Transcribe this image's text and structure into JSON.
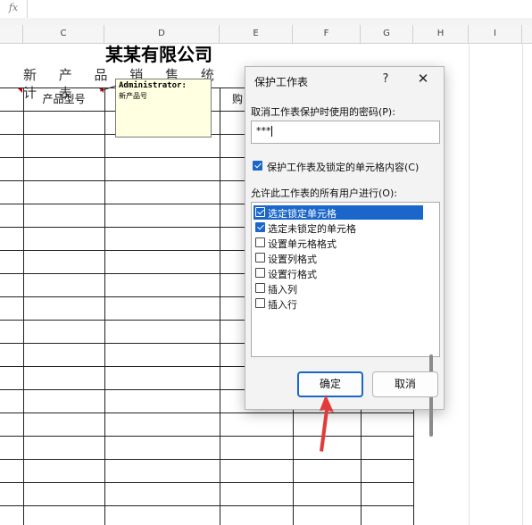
{
  "formula_bar": {
    "fx_label": "fx"
  },
  "columns": [
    "C",
    "D",
    "E",
    "F",
    "G",
    "H",
    "I"
  ],
  "sheet": {
    "title": "某某有限公司",
    "subtitle": "新 产 品 销 售 统 计 表",
    "headers": {
      "product_model": "产品型号",
      "purchase_partial": "购"
    }
  },
  "comment": {
    "author": "Administrator:",
    "text": "新产品号"
  },
  "dialog": {
    "title": "保护工作表",
    "help": "?",
    "close": "✕",
    "password_label": "取消工作表保护时使用的密码(P):",
    "password_value": "***",
    "protect_checkbox_label": "保护工作表及锁定的单元格内容(C)",
    "protect_checked": true,
    "allow_label": "允许此工作表的所有用户进行(O):",
    "permissions": [
      {
        "label": "选定锁定单元格",
        "checked": true
      },
      {
        "label": "选定未锁定的单元格",
        "checked": true
      },
      {
        "label": "设置单元格格式",
        "checked": false
      },
      {
        "label": "设置列格式",
        "checked": false
      },
      {
        "label": "设置行格式",
        "checked": false
      },
      {
        "label": "插入列",
        "checked": false
      },
      {
        "label": "插入行",
        "checked": false
      }
    ],
    "ok_label": "确定",
    "cancel_label": "取消"
  },
  "colors": {
    "accent": "#1a66c9",
    "arrow": "#e23b3b",
    "comment_bg": "#ffffe1"
  }
}
